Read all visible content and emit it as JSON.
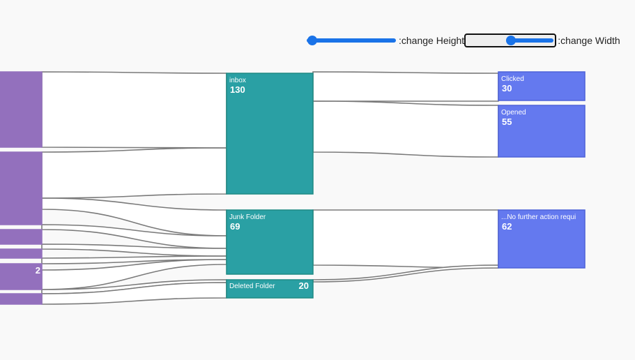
{
  "controls": {
    "height_label": ":change Height",
    "width_label": ":change Width"
  },
  "chart_data": {
    "type": "sankey",
    "colors": {
      "source": "#9370bd",
      "middle": "#2aa0a4",
      "middle_border": "#1f8a84",
      "target": "#6479ef",
      "target_border": "#4e63d8",
      "link": "#7a7a7a"
    },
    "nodes": [
      {
        "id": "s1",
        "name": "",
        "value": null
      },
      {
        "id": "s2",
        "name": "",
        "value": null
      },
      {
        "id": "s3",
        "name": "",
        "value": null
      },
      {
        "id": "s4",
        "name": "",
        "value": null
      },
      {
        "id": "s5",
        "name": "",
        "value": "2"
      },
      {
        "id": "s6",
        "name": "",
        "value": null
      },
      {
        "id": "inbox",
        "name": "inbox",
        "value": "130"
      },
      {
        "id": "junk",
        "name": "Junk Folder",
        "value": "69"
      },
      {
        "id": "deleted",
        "name": "Deleted Folder",
        "value": "20"
      },
      {
        "id": "clicked",
        "name": "Clicked",
        "value": "30"
      },
      {
        "id": "opened",
        "name": "Opened",
        "value": "55"
      },
      {
        "id": "noaction",
        "name": "...No further action requi",
        "value": "62"
      }
    ],
    "links": [
      {
        "source": "s1",
        "target": "inbox",
        "value": 63
      },
      {
        "source": "s2",
        "target": "inbox",
        "value": 43
      },
      {
        "source": "s2",
        "target": "junk",
        "value": 10
      },
      {
        "source": "s3",
        "target": "junk",
        "value": 8
      },
      {
        "source": "s4",
        "target": "junk",
        "value": 6
      },
      {
        "source": "s5",
        "target": "junk",
        "value": 4
      },
      {
        "source": "s5",
        "target": "deleted",
        "value": 2
      },
      {
        "source": "s6",
        "target": "inbox",
        "value": 10
      },
      {
        "source": "s6",
        "target": "deleted",
        "value": 8
      },
      {
        "source": "inbox",
        "target": "clicked",
        "value": 30
      },
      {
        "source": "inbox",
        "target": "opened",
        "value": 55
      },
      {
        "source": "junk",
        "target": "noaction",
        "value": 62
      },
      {
        "source": "deleted",
        "target": "noaction",
        "value": 1
      }
    ]
  }
}
